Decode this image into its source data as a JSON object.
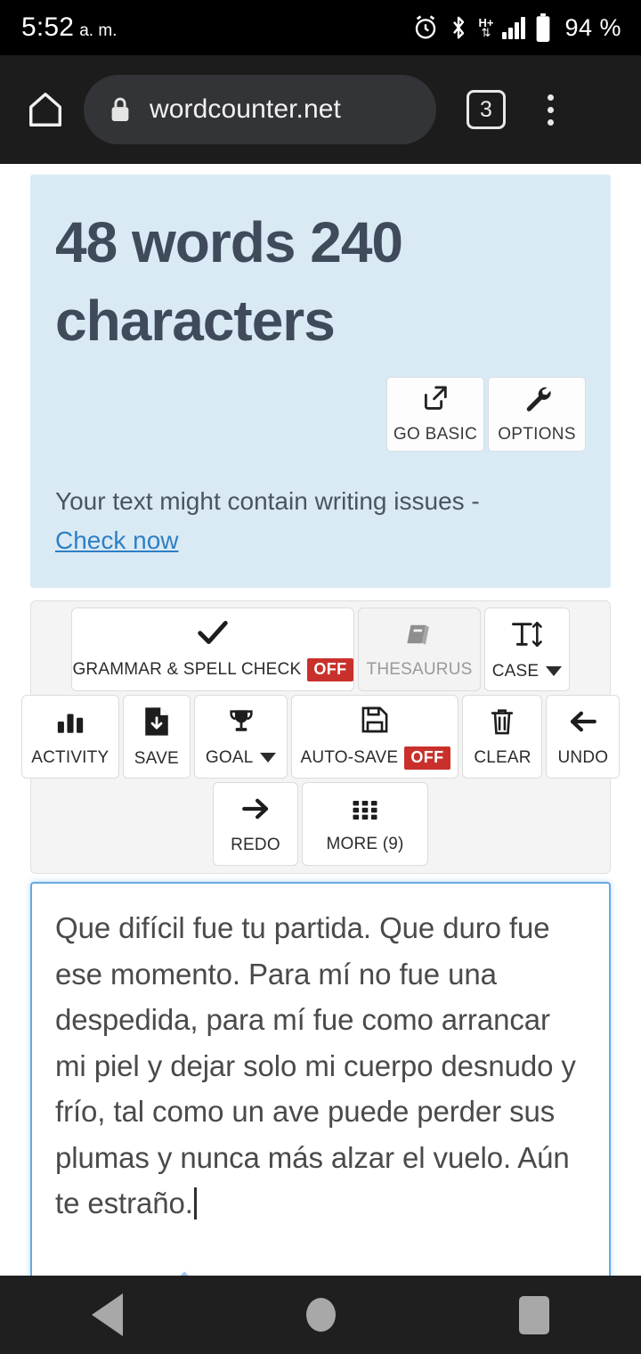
{
  "status_bar": {
    "time": "5:52",
    "ampm": "a. m.",
    "network_type": "H+",
    "battery_percent": "94 %",
    "icons": [
      "alarm-icon",
      "bluetooth-icon",
      "network-hplus-icon",
      "signal-bars-icon",
      "battery-icon"
    ]
  },
  "browser": {
    "url": "wordcounter.net",
    "tab_count": "3",
    "home_icon": "home-icon",
    "lock_icon": "lock-icon",
    "menu_icon": "kebab-menu-icon"
  },
  "counter_panel": {
    "title": "48 words 240 characters",
    "words": 48,
    "characters": 240,
    "background_color": "#d9eaf5",
    "text_color": "#3f4b5b",
    "buttons": [
      {
        "label": "GO BASIC",
        "icon": "external-link-icon"
      },
      {
        "label": "OPTIONS",
        "icon": "wrench-icon"
      }
    ],
    "writing_issues_text": "Your text might contain writing issues -",
    "writing_issues_link": "Check now",
    "link_color": "#2f7fc4"
  },
  "toolbar": {
    "badge_off_color": "#c9302c",
    "rows": [
      [
        {
          "label": "GRAMMAR & SPELL CHECK",
          "icon": "checkmark-icon",
          "badge": "OFF",
          "disabled": false,
          "caret": false
        },
        {
          "label": "THESAURUS",
          "icon": "book-icon",
          "badge": "",
          "disabled": true,
          "caret": false
        },
        {
          "label": "CASE",
          "icon": "text-size-icon",
          "badge": "",
          "disabled": false,
          "caret": true
        }
      ],
      [
        {
          "label": "ACTIVITY",
          "icon": "bar-chart-icon",
          "badge": "",
          "disabled": false,
          "caret": false
        },
        {
          "label": "SAVE",
          "icon": "file-download-icon",
          "badge": "",
          "disabled": false,
          "caret": false
        },
        {
          "label": "GOAL",
          "icon": "trophy-icon",
          "badge": "",
          "disabled": false,
          "caret": true
        },
        {
          "label": "AUTO-SAVE",
          "icon": "floppy-disk-icon",
          "badge": "OFF",
          "disabled": false,
          "caret": false
        },
        {
          "label": "CLEAR",
          "icon": "trash-icon",
          "badge": "",
          "disabled": false,
          "caret": false
        },
        {
          "label": "UNDO",
          "icon": "arrow-left-icon",
          "badge": "",
          "disabled": false,
          "caret": false
        }
      ],
      [
        {
          "label": "REDO",
          "icon": "arrow-right-icon",
          "badge": "",
          "disabled": false,
          "caret": false
        },
        {
          "label": "MORE (9)",
          "icon": "grid-dots-icon",
          "badge": "",
          "disabled": false,
          "caret": false
        }
      ]
    ]
  },
  "editor": {
    "text": "Que difícil fue tu partida. Que duro fue ese momento. Para mí no fue una despedida, para mí fue como arrancar mi piel y dejar solo mi cuerpo desnudo y frío, tal como un ave puede perder sus plumas y nunca más alzar el vuelo. Aún te estraño.",
    "focus_border_color": "#66a9e2",
    "handle_color": "#9fc6f2"
  },
  "nav_bar": {
    "back": "back-button",
    "home": "home-button",
    "recents": "recents-button"
  }
}
